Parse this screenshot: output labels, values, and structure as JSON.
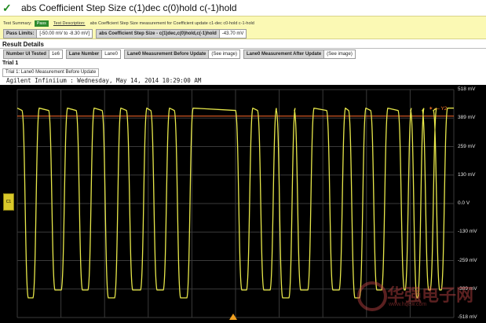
{
  "title": "abs Coefficient Step Size c(1)dec c(0)hold c(-1)hold",
  "summary": {
    "label": "Test Summary:",
    "status": "Pass",
    "desc_label": "Test Description:",
    "desc_text": "abs Coefficient Step Size measurement for Coefficient update c1-dec c0-hold c-1-hold"
  },
  "limits": {
    "pass_limits_label": "Pass Limits:",
    "pass_limits_value": "[-50.00 mV to -8.30 mV]",
    "measure_label": "abs Coefficient Step Size - c(1)dec,c(0)hold,c(-1)hold",
    "measure_value": "-43.70 mV"
  },
  "results": {
    "title": "Result Details",
    "fields": [
      {
        "label": "Number UI Tested",
        "value": "1e6"
      },
      {
        "label": "Lane Number",
        "value": "Lane0"
      },
      {
        "label": "Lane0 Measurement Before Update",
        "value": "(See image)"
      },
      {
        "label": "Lane0 Measurement After Update",
        "value": "(See image)"
      }
    ]
  },
  "trial": {
    "title": "Trial 1",
    "label": "Trial 1: Lane0 Measurement Before Update",
    "header": "Agilent Infiniium : Wednesday, May 14, 2014 10:29:00 AM"
  },
  "scope": {
    "y_labels": [
      "518 mV",
      "389 mV",
      "259 mV",
      "130 mV",
      "0.0 V",
      "-130 mV",
      "-259 mV",
      "-389 mV",
      "-518 mV"
    ],
    "marker": "Y2",
    "channel": "C1",
    "colors": {
      "trace": "#e8e84a",
      "grid": "#3a3a3a",
      "marker": "#ff6a2a",
      "background": "#000000"
    }
  },
  "watermark": {
    "text": "华强电子网",
    "url": "www.hqew.com"
  }
}
